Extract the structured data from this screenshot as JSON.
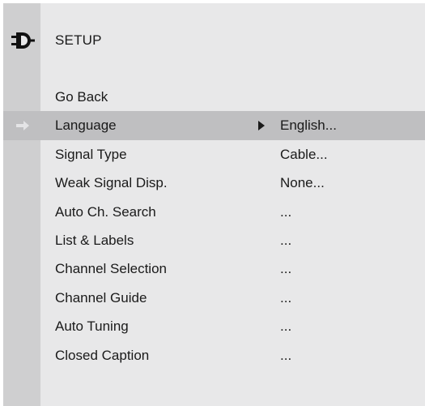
{
  "menu": {
    "icon": "setup-plug-icon",
    "title": "SETUP",
    "selected_index": 1,
    "items": [
      {
        "label": "Go Back",
        "value": ""
      },
      {
        "label": "Language",
        "value": "English..."
      },
      {
        "label": "Signal Type",
        "value": "Cable..."
      },
      {
        "label": "Weak Signal Disp.",
        "value": "None..."
      },
      {
        "label": "Auto Ch. Search",
        "value": "..."
      },
      {
        "label": "List & Labels",
        "value": "..."
      },
      {
        "label": "Channel Selection",
        "value": "..."
      },
      {
        "label": "Channel Guide",
        "value": "..."
      },
      {
        "label": "Auto Tuning",
        "value": "..."
      },
      {
        "label": "Closed Caption",
        "value": "..."
      }
    ]
  },
  "colors": {
    "menu_background": "#e8e8e9",
    "left_strip": "#cfcfd0",
    "selected_row": "#bfbfc1",
    "text": "#1a1a1a"
  }
}
